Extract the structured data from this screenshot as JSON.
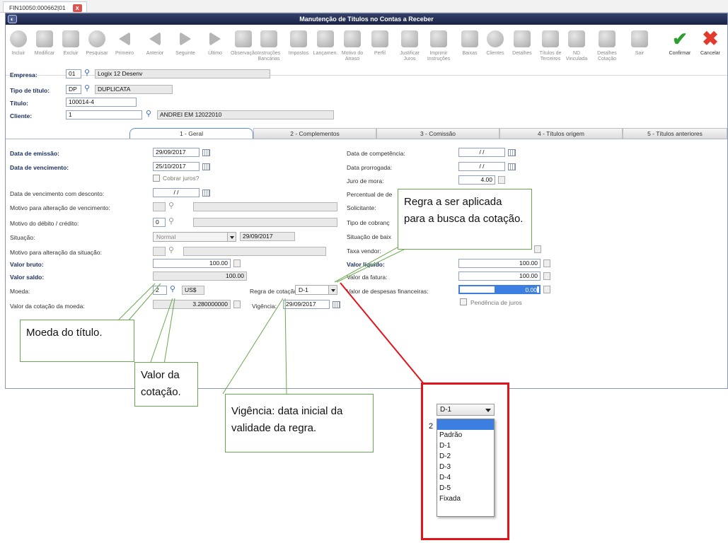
{
  "doc_tab": {
    "label": "FIN10050:000662|01",
    "close": "x"
  },
  "window": {
    "title": "Manutenção de Títulos no Contas a Receber",
    "sysicon": "system-menu-icon"
  },
  "toolbar": [
    {
      "label": "Incluir"
    },
    {
      "label": "Modificar"
    },
    {
      "label": "Excluir"
    },
    {
      "label": "Pesquisar"
    },
    {
      "label": "Primeiro"
    },
    {
      "label": "Anterior"
    },
    {
      "label": "Seguinte"
    },
    {
      "label": "Último"
    },
    {
      "label": "Observação"
    },
    {
      "label": "Instruções Bancárias"
    },
    {
      "label": "Impostos"
    },
    {
      "label": "Lançamen."
    },
    {
      "label": "Motivo do Atraso"
    },
    {
      "label": "Perfil"
    },
    {
      "label": "Justificar Juros"
    },
    {
      "label": "Imprimir Instruções"
    },
    {
      "label": "Baixas"
    },
    {
      "label": "Clientes"
    },
    {
      "label": "Detalhes"
    },
    {
      "label": "Títulos de Terceiros"
    },
    {
      "label": "ND Vinculada"
    },
    {
      "label": "Detalhes Cotação"
    },
    {
      "label": "Sair"
    },
    {
      "label": "Confirmar"
    },
    {
      "label": "Cancelar"
    }
  ],
  "header": {
    "empresa": {
      "label": "Empresa:",
      "code": "01",
      "name": "Logix 12 Desenv"
    },
    "tipo_titulo": {
      "label": "Tipo de título:",
      "code": "DP",
      "name": "DUPLICATA"
    },
    "titulo": {
      "label": "Título:",
      "value": "100014-4"
    },
    "cliente": {
      "label": "Cliente:",
      "code": "1",
      "name": "ANDREI EM 12022010"
    }
  },
  "tabs": [
    {
      "label": "1 - Geral"
    },
    {
      "label": "2 - Complementos"
    },
    {
      "label": "3 - Comissão"
    },
    {
      "label": "4 - Títulos origem"
    },
    {
      "label": "5 - Títulos anteriores"
    }
  ],
  "left": {
    "data_emissao": {
      "label": "Data de emissão:",
      "value": "29/09/2017"
    },
    "data_vencimento": {
      "label": "Data de vencimento:",
      "value": "25/10/2017"
    },
    "cobrar_juros": {
      "label": "Cobrar juros?"
    },
    "venc_desconto": {
      "label": "Data de vencimento com desconto:",
      "value": "/ /"
    },
    "motivo_venc": {
      "label": "Motivo para alteração de vencimento:"
    },
    "motivo_debito": {
      "label": "Motivo do débito / crédito:",
      "value": "0"
    },
    "situacao": {
      "label": "Situação:",
      "value": "Normal",
      "date": "29/09/2017"
    },
    "motivo_situacao": {
      "label": "Motivo para alteração da situação:"
    },
    "valor_bruto": {
      "label": "Valor bruto:",
      "value": "100.00"
    },
    "valor_saldo": {
      "label": "Valor saldo:",
      "value": "100.00"
    },
    "moeda": {
      "label": "Moeda:",
      "code": "2",
      "name": "US$"
    },
    "regra_cotacao": {
      "label": "Regra de cotação:",
      "value": "D-1"
    },
    "valor_cotacao": {
      "label": "Valor da cotação da moeda:",
      "value": "3.280000000"
    },
    "vigencia": {
      "label": "Vigência:",
      "value": "29/09/2017"
    }
  },
  "right": {
    "data_competencia": {
      "label": "Data de competência:",
      "value": "/ /"
    },
    "data_prorrogada": {
      "label": "Data prorrogada:",
      "value": "/ /"
    },
    "juro_mora": {
      "label": "Juro de mora:",
      "value": "4.00"
    },
    "percentual": {
      "label": "Percentual de de"
    },
    "solicitante": {
      "label": "Solicitante:"
    },
    "tipo_cobranca": {
      "label": "Tipo de cobranç"
    },
    "situacao_baixa": {
      "label": "Situação de baix"
    },
    "taxa_vendor": {
      "label": "Taxa vendor:"
    },
    "valor_liquido": {
      "label": "Valor líquido:",
      "value": "100.00"
    },
    "valor_fatura": {
      "label": "Valor da fatura:",
      "value": "100.00"
    },
    "valor_despesas": {
      "label": "Valor de despesas financeiras:",
      "value": "0.00"
    },
    "pendencia_juros": {
      "label": "Pendência de juros"
    }
  },
  "callouts": {
    "regra": "Regra a ser aplicada para a busca da cotação.",
    "moeda": "Moeda do título.",
    "valor": "Valor da cotação.",
    "vigencia": "Vigência: data inicial da validade da regra."
  },
  "dropdown": {
    "selected": "D-1",
    "behind_char": "2",
    "options": [
      "",
      "Padrão",
      "D-1",
      "D-2",
      "D-3",
      "D-4",
      "D-5",
      "Fixada"
    ]
  },
  "colors": {
    "titlebar": "#1a2447",
    "highlight_border": "#e2141b",
    "callout_line": "#6aa84f",
    "selection": "#3c7fe0"
  }
}
